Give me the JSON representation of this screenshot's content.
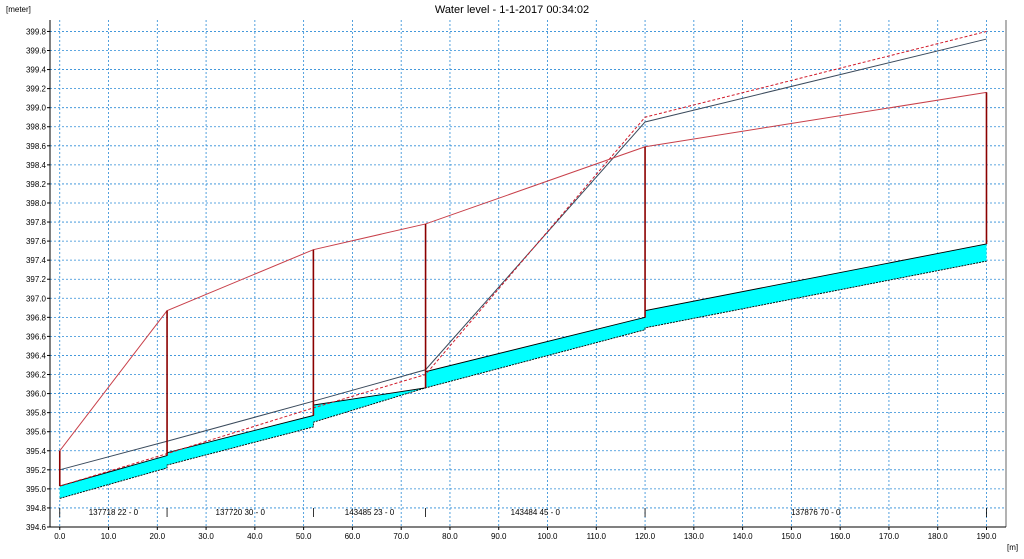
{
  "chart_data": {
    "type": "line",
    "title": "Water level - 1-1-2017 00:34:02",
    "ylabel": "[meter]",
    "xlabel": "[m]",
    "xlim": [
      -2,
      194
    ],
    "ylim": [
      394.6,
      399.92
    ],
    "x_ticks": [
      0,
      10,
      20,
      30,
      40,
      50,
      60,
      70,
      80,
      90,
      100,
      110,
      120,
      130,
      140,
      150,
      160,
      170,
      180,
      190
    ],
    "x_tick_labels": [
      "0.0",
      "10.0",
      "20.0",
      "30.0",
      "40.0",
      "50.0",
      "60.0",
      "70.0",
      "80.0",
      "90.0",
      "100.0",
      "110.0",
      "120.0",
      "130.0",
      "140.0",
      "150.0",
      "160.0",
      "170.0",
      "180.0",
      "190.0"
    ],
    "y_ticks": [
      394.6,
      394.8,
      395.0,
      395.2,
      395.4,
      395.6,
      395.8,
      396.0,
      396.2,
      396.4,
      396.6,
      396.8,
      397.0,
      397.2,
      397.4,
      397.6,
      397.8,
      398.0,
      398.2,
      398.4,
      398.6,
      398.8,
      399.0,
      399.2,
      399.4,
      399.6,
      399.8
    ],
    "y_tick_labels": [
      "394.6",
      "394.8",
      "395.0",
      "395.2",
      "395.4",
      "395.6",
      "395.8",
      "396.0",
      "396.2",
      "396.4",
      "396.6",
      "396.8",
      "397.0",
      "397.2",
      "397.4",
      "397.6",
      "397.8",
      "398.0",
      "398.2",
      "398.4",
      "398.6",
      "398.8",
      "399.0",
      "399.2",
      "399.4",
      "399.6",
      "399.8"
    ],
    "grid": true,
    "node_x": [
      0,
      22,
      52,
      75,
      120,
      190
    ],
    "series": [
      {
        "x": [
          0,
          22,
          52,
          75,
          120,
          190
        ],
        "y": [
          395.2,
          395.5,
          395.92,
          396.25,
          398.85,
          399.72
        ],
        "color": "#3a4a5c",
        "dash": false
      },
      {
        "x": [
          0,
          22,
          52,
          75,
          120,
          190
        ],
        "y": [
          395.03,
          395.37,
          395.85,
          396.2,
          398.9,
          399.8
        ],
        "color": "#d11a2a",
        "dash": true
      },
      {
        "x": [
          0,
          22,
          52,
          75,
          120,
          190
        ],
        "y": [
          395.4,
          396.87,
          397.51,
          397.78,
          398.59,
          399.16
        ],
        "color": "#c8404a",
        "dash": false
      }
    ],
    "bed_top": {
      "x": [
        0,
        22,
        22,
        52,
        52,
        75,
        75,
        120,
        120,
        190
      ],
      "y": [
        395.03,
        395.35,
        395.38,
        395.77,
        395.88,
        396.06,
        396.23,
        396.8,
        396.87,
        397.57
      ]
    },
    "bed_bottom": {
      "x": [
        0,
        22,
        22,
        52,
        52,
        75,
        75,
        120,
        120,
        190
      ],
      "y": [
        394.9,
        395.22,
        395.25,
        395.65,
        395.7,
        396.06,
        396.06,
        396.67,
        396.69,
        397.39
      ]
    },
    "bed_color": "#00ffff",
    "branches": [
      {
        "label": "137718  22 - 0"
      },
      {
        "label": "137720  30 - 0"
      },
      {
        "label": "143485  23 - 0"
      },
      {
        "label": "143484  45 - 0"
      },
      {
        "label": "137876  70 - 0"
      }
    ]
  }
}
